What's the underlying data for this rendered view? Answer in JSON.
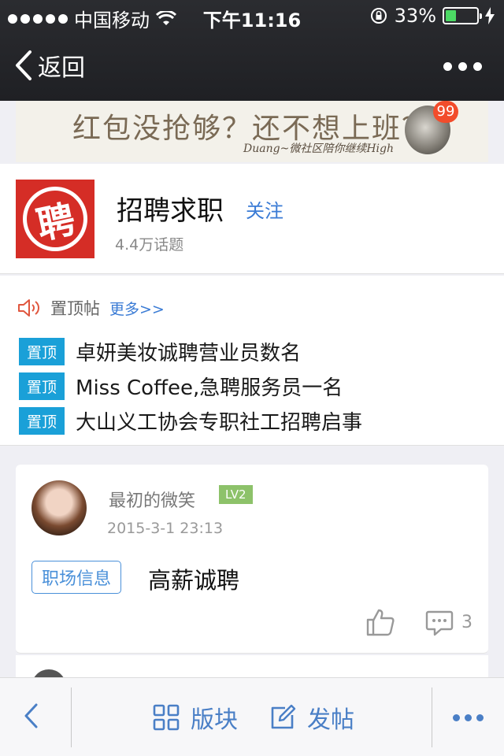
{
  "status_bar": {
    "carrier": "中国移动",
    "time": "下午11:16",
    "battery": "33%",
    "battery_level": 0.33
  },
  "nav": {
    "back_label": "返回"
  },
  "banner": {
    "headline": "红包没抢够？还不想上班？",
    "tagline": "Duang~微社区陪你继续High",
    "badge": "99"
  },
  "forum": {
    "logo_char": "聘",
    "title": "招聘求职",
    "follow_label": "关注",
    "topic_count": "4.4万话题"
  },
  "pinned": {
    "header_label": "置顶帖",
    "more_label": "更多>>",
    "tag_label": "置顶",
    "items": [
      "卓妍美妆诚聘营业员数名",
      "Miss Coffee,急聘服务员一名",
      "大山义工协会专职社工招聘启事"
    ]
  },
  "post": {
    "username": "最初的微笑",
    "level": "LV2",
    "timestamp": "2015-3-1 23:13",
    "category": "职场信息",
    "title": "高薪诚聘",
    "comment_count": "3"
  },
  "bottom_bar": {
    "section_label": "版块",
    "post_label": "发帖"
  },
  "colors": {
    "accent": "#3a7bd5",
    "pin_tag": "#1aa0d8",
    "level_badge": "#8dc26a",
    "logo_red": "#d52d26"
  }
}
